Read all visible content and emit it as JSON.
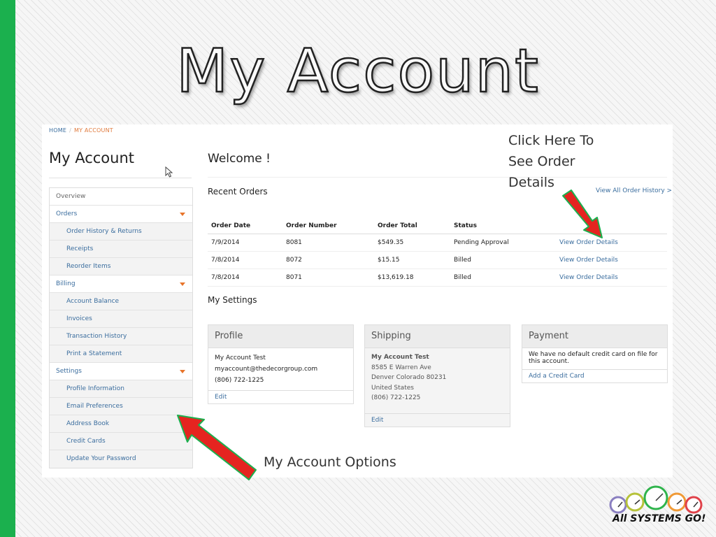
{
  "slide": {
    "title": "My Account",
    "callout_order_details": "Click Here To See Order Details",
    "callout_account_options": "My Account Options",
    "logo_text": "All SYSTEMS GO!",
    "accent_color": "#1bb04e",
    "arrow_color": "#e52420"
  },
  "breadcrumb": {
    "home": "HOME",
    "separator": "/",
    "current": "MY ACCOUNT"
  },
  "page": {
    "heading": "My Account",
    "welcome": "Welcome !"
  },
  "sidebar": {
    "items": [
      {
        "label": "Overview"
      },
      {
        "label": "Orders"
      },
      {
        "label": "Order History & Returns"
      },
      {
        "label": "Receipts"
      },
      {
        "label": "Reorder Items"
      },
      {
        "label": "Billing"
      },
      {
        "label": "Account Balance"
      },
      {
        "label": "Invoices"
      },
      {
        "label": "Transaction History"
      },
      {
        "label": "Print a Statement"
      },
      {
        "label": "Settings"
      },
      {
        "label": "Profile Information"
      },
      {
        "label": "Email Preferences"
      },
      {
        "label": "Address Book"
      },
      {
        "label": "Credit Cards"
      },
      {
        "label": "Update Your Password"
      }
    ]
  },
  "recent_orders": {
    "title": "Recent Orders",
    "view_all": "View All Order History >",
    "columns": [
      "Order Date",
      "Order Number",
      "Order Total",
      "Status"
    ],
    "rows": [
      {
        "date": "7/9/2014",
        "number": "8081",
        "total": "$549.35",
        "status": "Pending Approval",
        "link": "View Order Details"
      },
      {
        "date": "7/8/2014",
        "number": "8072",
        "total": "$15.15",
        "status": "Billed",
        "link": "View Order Details"
      },
      {
        "date": "7/8/2014",
        "number": "8071",
        "total": "$13,619.18",
        "status": "Billed",
        "link": "View Order Details"
      }
    ]
  },
  "settings": {
    "title": "My Settings",
    "profile": {
      "title": "Profile",
      "name": "My Account Test",
      "email": "myaccount@thedecorgroup.com",
      "phone": "(806) 722-1225",
      "edit": "Edit"
    },
    "shipping": {
      "title": "Shipping",
      "name": "My Account Test",
      "street": "8585 E Warren Ave",
      "city": "Denver Colorado 80231",
      "country": "United States",
      "phone": "(806) 722-1225",
      "edit": "Edit"
    },
    "payment": {
      "title": "Payment",
      "message": "We have no default credit card on file for this account.",
      "add": "Add a Credit Card"
    }
  }
}
